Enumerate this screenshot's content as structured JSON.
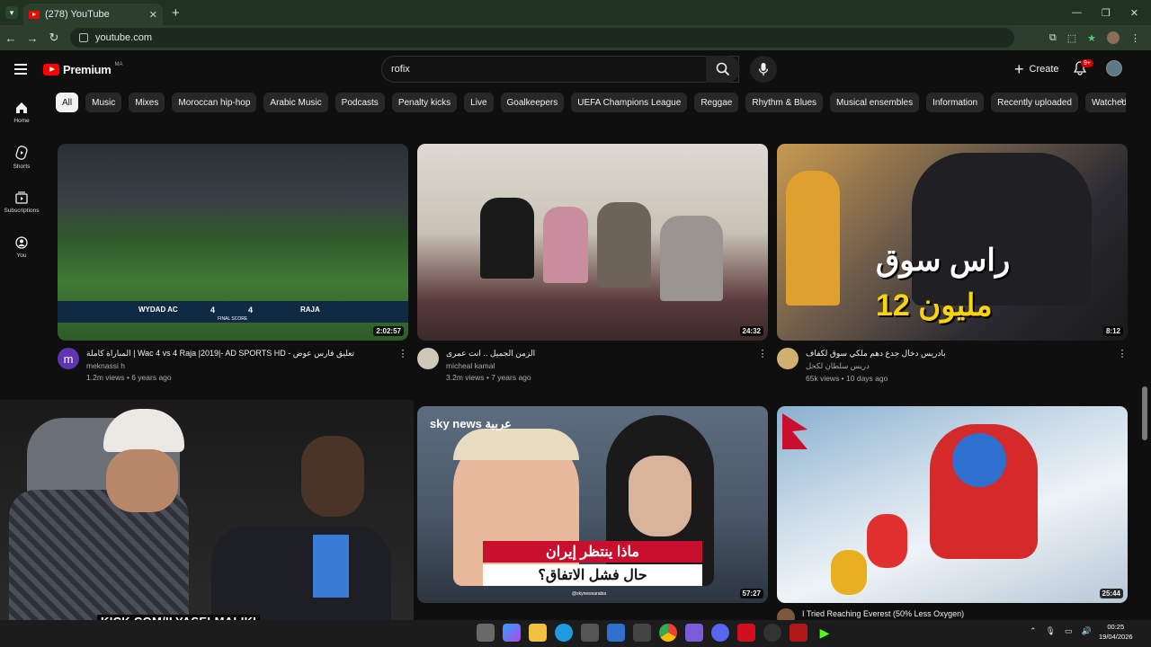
{
  "browser": {
    "tab_title": "(278) YouTube",
    "url": "youtube.com"
  },
  "youtube": {
    "brand": "Premium",
    "country_code": "MA",
    "search_value": "rofix",
    "create_label": "Create",
    "notification_count": "9+"
  },
  "sidebar": [
    {
      "label": "Home",
      "icon": "home-icon"
    },
    {
      "label": "Shorts",
      "icon": "shorts-icon"
    },
    {
      "label": "Subscriptions",
      "icon": "subscriptions-icon"
    },
    {
      "label": "You",
      "icon": "you-icon"
    }
  ],
  "chips": [
    "All",
    "Music",
    "Mixes",
    "Moroccan hip-hop",
    "Arabic Music",
    "Podcasts",
    "Penalty kicks",
    "Live",
    "Goalkeepers",
    "UEFA Champions League",
    "Reggae",
    "Rhythm & Blues",
    "Musical ensembles",
    "Information",
    "Recently uploaded",
    "Watched"
  ],
  "videos": [
    {
      "title": "المباراة كاملة | Wac 4 vs 4 Raja |2019|- AD SPORTS HD - تعليق فارس عوض",
      "channel": "meknassi h",
      "stats": "1.2m views • 6 years ago",
      "duration": "2:02:57",
      "avatar_letter": "m",
      "thumb_text_left": "WYDAD AC",
      "thumb_text_right": "RAJA",
      "thumb_score": "4",
      "thumb_label": "FINAL SCORE"
    },
    {
      "title": "الزمن الجميل .. انت عمرى",
      "channel": "micheal kamal",
      "stats": "3.2m views • 7 years ago",
      "duration": "24:32",
      "avatar_letter": ""
    },
    {
      "title": "بادريس دخال جدع دهم ملكي سوق لكفاف",
      "channel": "دريس سلطان لكحل",
      "stats": "65k views • 10 days ago",
      "duration": "8:12",
      "avatar_letter": "",
      "thumb_line1": "راس سوق",
      "thumb_line2": "12 مليون"
    },
    {
      "title": "",
      "channel": "",
      "stats": "",
      "duration": ""
    },
    {
      "title": "",
      "channel": "",
      "stats": "",
      "duration": "57:27",
      "thumb_brand": "sky news عربية",
      "thumb_line1": "ماذا ينتظر إيران",
      "thumb_line2": "حال فشل الاتفاق؟",
      "thumb_handle": "@skynewsarabia"
    },
    {
      "title": "I Tried Reaching Everest (50% Less Oxygen)",
      "channel": "",
      "stats": "",
      "duration": "25:44"
    }
  ],
  "overlay": {
    "kick_text": "KICK.COM/ILYASELMALIKI"
  },
  "taskbar": {
    "time": "00:25",
    "date": "19/04/2026"
  },
  "colors": {
    "browser_frame": "#1f3320",
    "yt_bg": "#0f0f0f",
    "accent_red": "#ff0000",
    "kick_green": "#53fc18"
  }
}
